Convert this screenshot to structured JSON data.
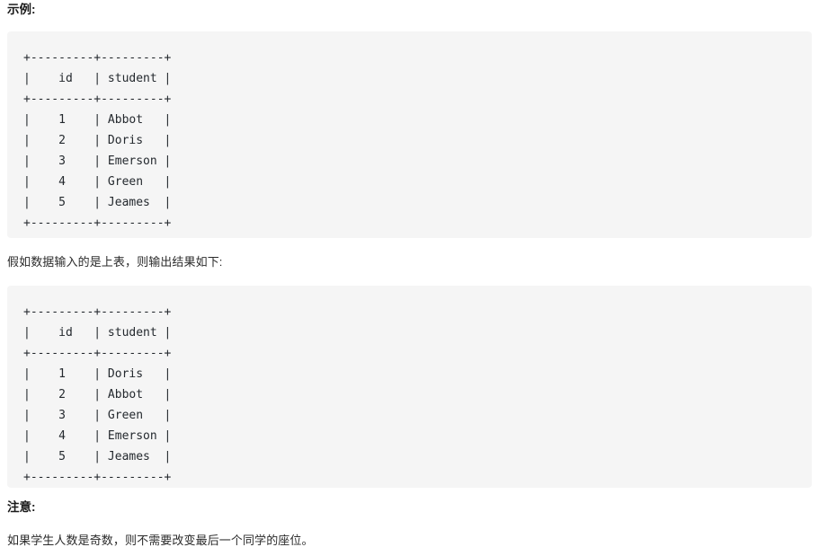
{
  "headings": {
    "example": "示例:",
    "note": "注意:"
  },
  "paragraphs": {
    "explain": "假如数据输入的是上表，则输出结果如下:",
    "note": "如果学生人数是奇数，则不需要改变最后一个同学的座位。"
  },
  "code_blocks": {
    "input": {
      "columns": [
        "id",
        "student"
      ],
      "rows": [
        {
          "id": "1",
          "student": "Abbot"
        },
        {
          "id": "2",
          "student": "Doris"
        },
        {
          "id": "3",
          "student": "Emerson"
        },
        {
          "id": "4",
          "student": "Green"
        },
        {
          "id": "5",
          "student": "Jeames"
        }
      ],
      "text": "+---------+---------+\n|    id   | student |\n+---------+---------+\n|    1    | Abbot   |\n|    2    | Doris   |\n|    3    | Emerson |\n|    4    | Green   |\n|    5    | Jeames  |\n+---------+---------+"
    },
    "output": {
      "columns": [
        "id",
        "student"
      ],
      "rows": [
        {
          "id": "1",
          "student": "Doris"
        },
        {
          "id": "2",
          "student": "Abbot"
        },
        {
          "id": "3",
          "student": "Green"
        },
        {
          "id": "4",
          "student": "Emerson"
        },
        {
          "id": "5",
          "student": "Jeames"
        }
      ],
      "text": "+---------+---------+\n|    id   | student |\n+---------+---------+\n|    1    | Doris   |\n|    2    | Abbot   |\n|    3    | Green   |\n|    4    | Emerson |\n|    5    | Jeames  |\n+---------+---------+"
    }
  },
  "colors": {
    "page_background": "#ffffff",
    "code_background": "#f5f5f5",
    "text": "#1f1f1f",
    "code_text": "#24292e"
  }
}
